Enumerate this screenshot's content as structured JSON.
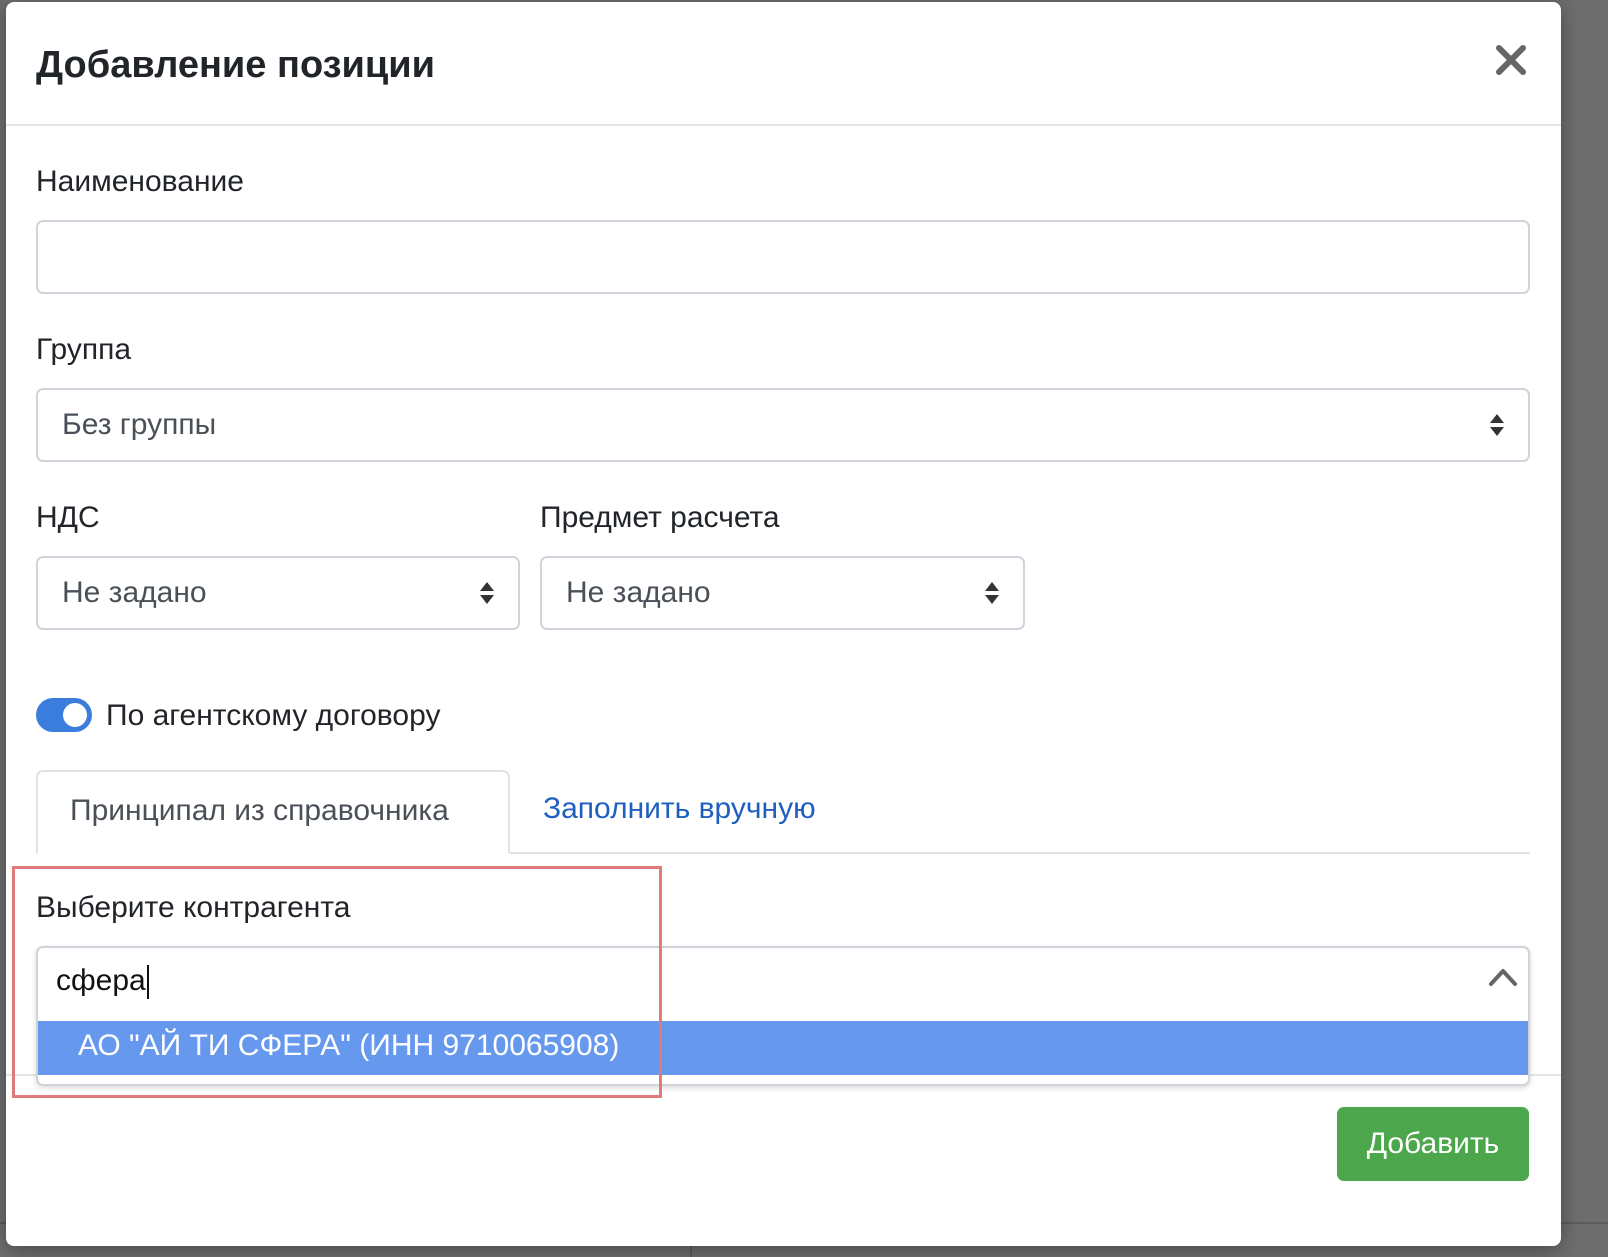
{
  "modal": {
    "title": "Добавление позиции",
    "close_icon": "close-icon"
  },
  "form": {
    "name": {
      "label": "Наименование",
      "value": ""
    },
    "group": {
      "label": "Группа",
      "selected": "Без группы"
    },
    "vat": {
      "label": "НДС",
      "selected": "Не задано"
    },
    "payment_subject": {
      "label": "Предмет расчета",
      "selected": "Не задано"
    },
    "agent_toggle": {
      "label": "По агентскому договору",
      "checked": true
    },
    "tabs": [
      {
        "label": "Принципал из справочника",
        "active": true
      },
      {
        "label": "Заполнить вручную",
        "active": false
      }
    ],
    "counterparty": {
      "label": "Выберите контрагента",
      "query": "сфера",
      "options": [
        {
          "label": "АО \"АЙ ТИ СФЕРА\" (ИНН 9710065908)",
          "highlighted": true
        }
      ]
    }
  },
  "footer": {
    "submit_label": "Добавить"
  },
  "colors": {
    "accent": "#3b7ddd",
    "link": "#1f5fbf",
    "option_highlight": "#6699ee",
    "submit": "#4ca64c",
    "annotation_box": "#e07b7b"
  }
}
